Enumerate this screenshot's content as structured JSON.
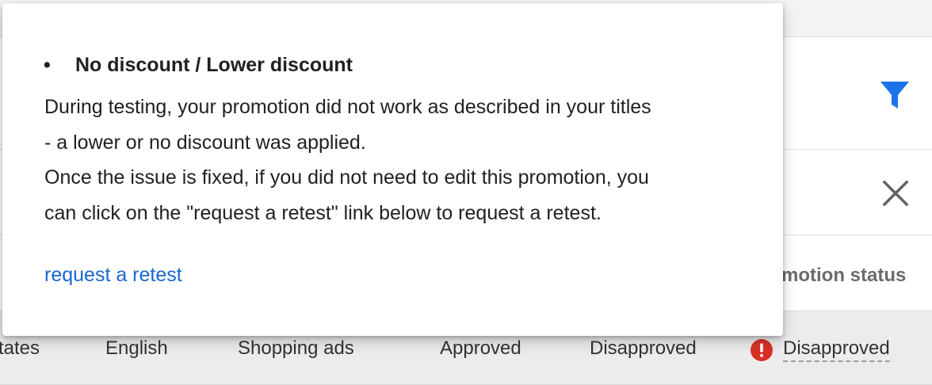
{
  "background": {
    "column_header": "motion status",
    "row": {
      "cells": [
        "tates",
        "English",
        "Shopping ads",
        "Approved",
        "Disapproved"
      ],
      "status": "Disapproved"
    }
  },
  "popover": {
    "bullet": "•",
    "title": "No discount / Lower discount",
    "body_lines": [
      "During testing, your promotion did not work as described in your titles",
      "- a lower or no discount was applied.",
      "Once the issue is fixed, if you did not need to edit this promotion, you",
      "can click on the \"request a retest\" link below to request a retest."
    ],
    "link": "request a retest"
  },
  "icons": {
    "filter": "filter-icon",
    "close": "close-icon",
    "alert": "alert-icon"
  },
  "colors": {
    "accent": "#1a73e8",
    "link": "#1967d2",
    "error": "#d93025",
    "icon_gray": "#5f6368"
  }
}
